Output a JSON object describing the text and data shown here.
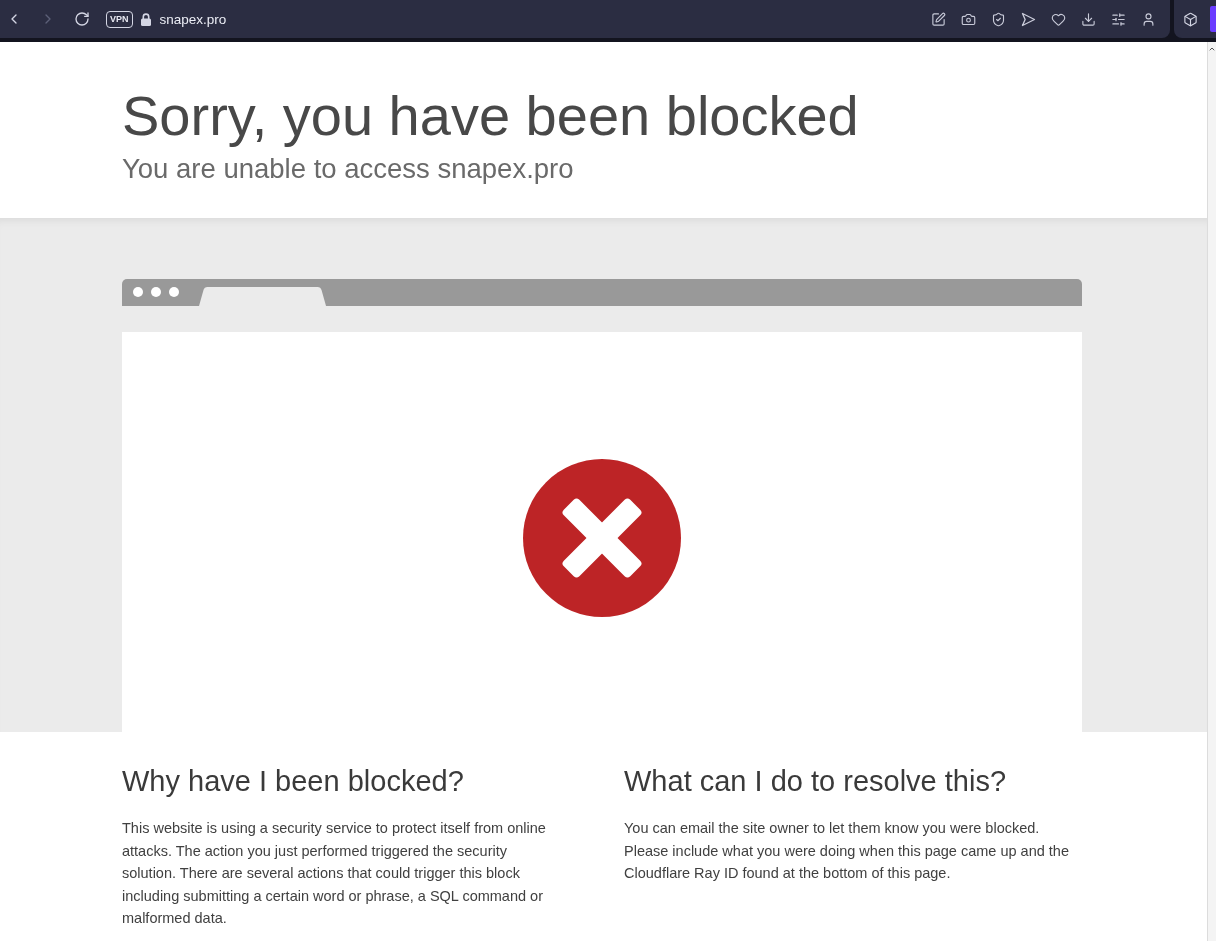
{
  "browser": {
    "nav": [
      {
        "kind": "back",
        "disabled": false
      },
      {
        "kind": "forward",
        "disabled": true
      },
      {
        "kind": "reload",
        "disabled": false
      }
    ],
    "vpn_badge": "VPN",
    "url": "snapex.pro"
  },
  "header": {
    "title": "Sorry, you have been blocked",
    "subtitle": "You are unable to access snapex.pro"
  },
  "sections": [
    {
      "title": "Why have I been blocked?",
      "text": "This website is using a security service to protect itself from online attacks. The action you just performed triggered the security solution. There are several actions that could trigger this block including submitting a certain word or phrase, a SQL command or malformed data."
    },
    {
      "title": "What can I do to resolve this?",
      "text": "You can email the site owner to let them know you were blocked. Please include what you were doing when this page came up and the Cloudflare Ray ID found at the bottom of this page."
    }
  ]
}
